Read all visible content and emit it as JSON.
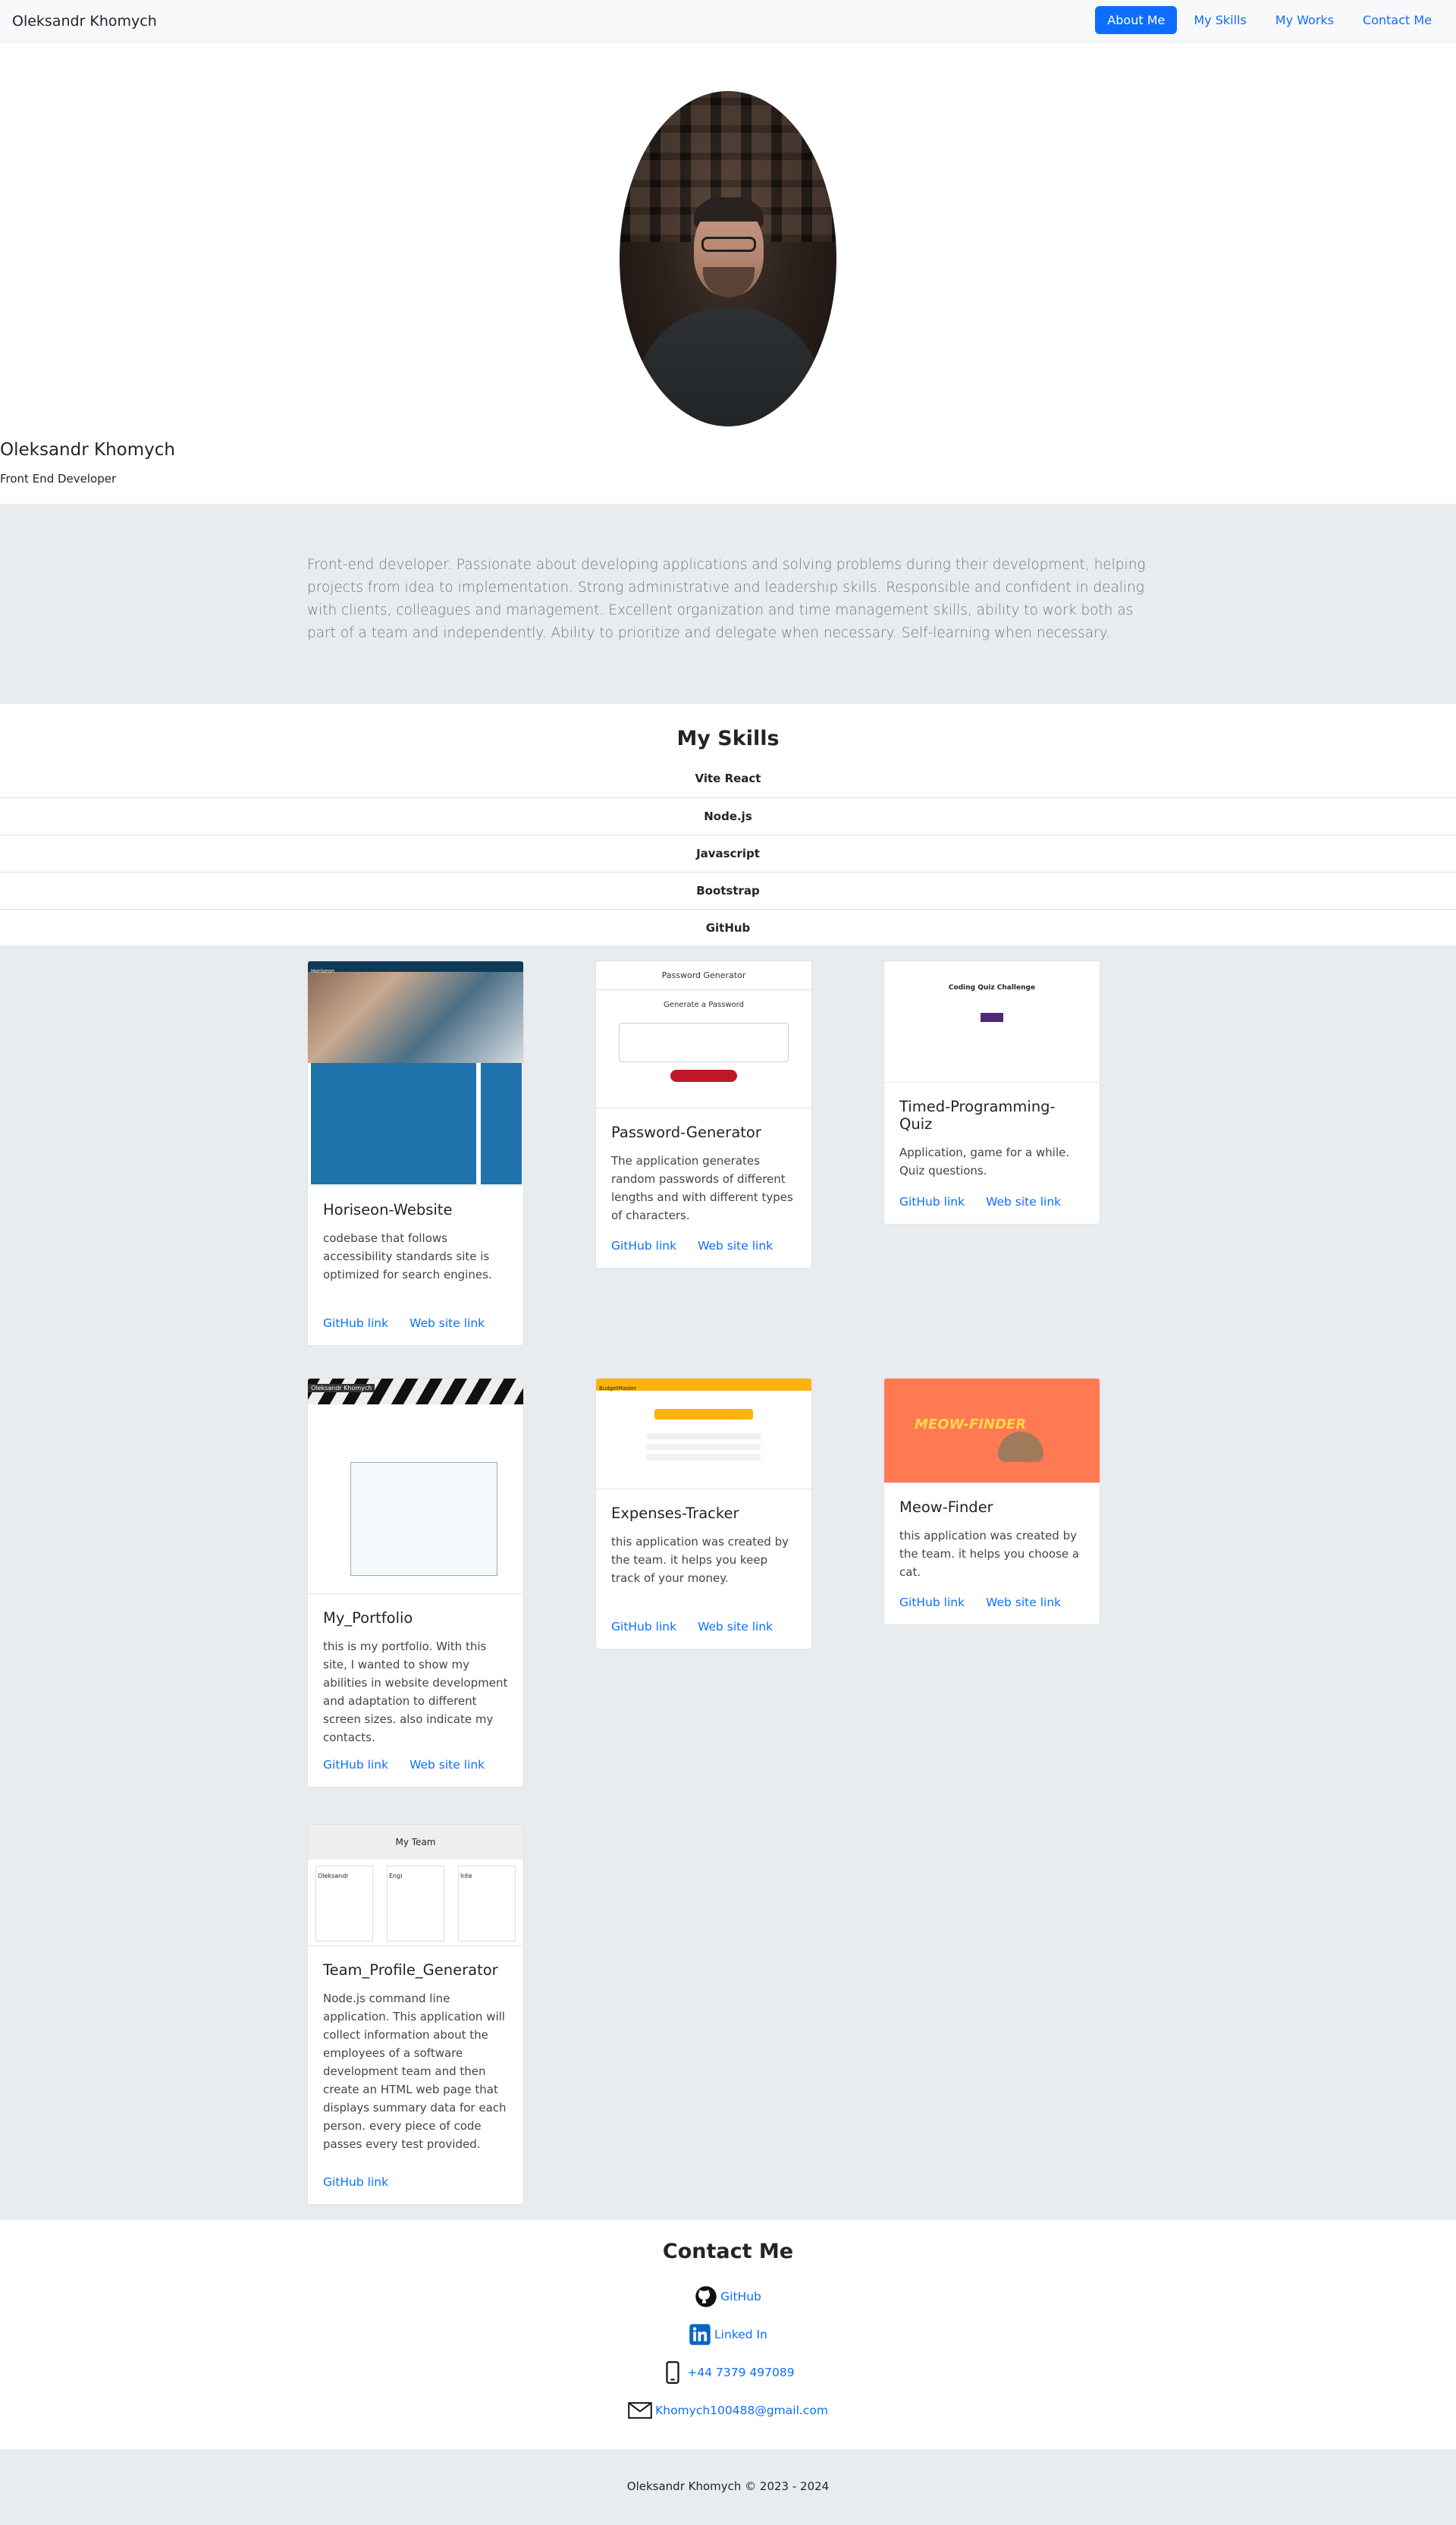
{
  "nav": {
    "brand": "Oleksandr Khomych",
    "links": [
      {
        "label": "About Me",
        "active": true
      },
      {
        "label": "My Skills",
        "active": false
      },
      {
        "label": "My Works",
        "active": false
      },
      {
        "label": "Contact Me",
        "active": false
      }
    ]
  },
  "profile": {
    "name": "Oleksandr Khomych",
    "role": "Front End Developer"
  },
  "about": {
    "text": "Front-end developer. Passionate about developing applications and solving problems during their development, helping projects from idea to implementation. Strong administrative and leadership skills. Responsible and confident in dealing with clients, colleagues and management. Excellent organization and time management skills, ability to work both as part of a team and independently. Ability to prioritize and delegate when necessary. Self-learning when necessary."
  },
  "skills": {
    "title": "My Skills",
    "items": [
      "Vite React",
      "Node.js",
      "Javascript",
      "Bootstrap",
      "GitHub"
    ]
  },
  "works": {
    "github_label": "GitHub link",
    "site_label": "Web site link",
    "projects": [
      {
        "title": "Horiseon-Website",
        "description": "codebase that follows accessibility standards site is optimized for search engines.",
        "thumb_text": "Horiseon"
      },
      {
        "title": "Password-Generator",
        "description": "The application generates random passwords of different lengths and with different types of characters.",
        "thumb_text": "Password Generator",
        "thumb_sub": "Generate a Password"
      },
      {
        "title": "Timed-Programming-Quiz",
        "description": "Application, game for a while. Quiz questions.",
        "thumb_text": "Coding Quiz Challenge"
      },
      {
        "title": "My_Portfolio",
        "description": "this is my portfolio. With this site, I wanted to show my abilities in website development and adaptation to different screen sizes. also indicate my contacts.",
        "thumb_text": "Oleksandr Khomych"
      },
      {
        "title": "Expenses-Tracker",
        "description": "this application was created by the team. it helps you keep track of your money.",
        "thumb_text": "BudgetMaster"
      },
      {
        "title": "Meow-Finder",
        "description": "this application was created by the team. it helps you choose a cat.",
        "thumb_text": "MEOW-FINDER"
      },
      {
        "title": "Team_Profile_Generator",
        "description": "Node.js command line application. This application will collect information about the employees of a software development team and then create an HTML web page that displays summary data for each person. every piece of code passes every test provided.",
        "thumb_text": "My Team",
        "team_members": [
          "Oleksandr",
          "Engi",
          "Inte"
        ]
      }
    ]
  },
  "contact": {
    "title": "Contact Me",
    "github": "GitHub",
    "linkedin": "Linked In",
    "phone": "+44 7379 497089",
    "email": "Khomych100488@gmail.com"
  },
  "footer": {
    "text": "Oleksandr Khomych © 2023 - 2024"
  }
}
